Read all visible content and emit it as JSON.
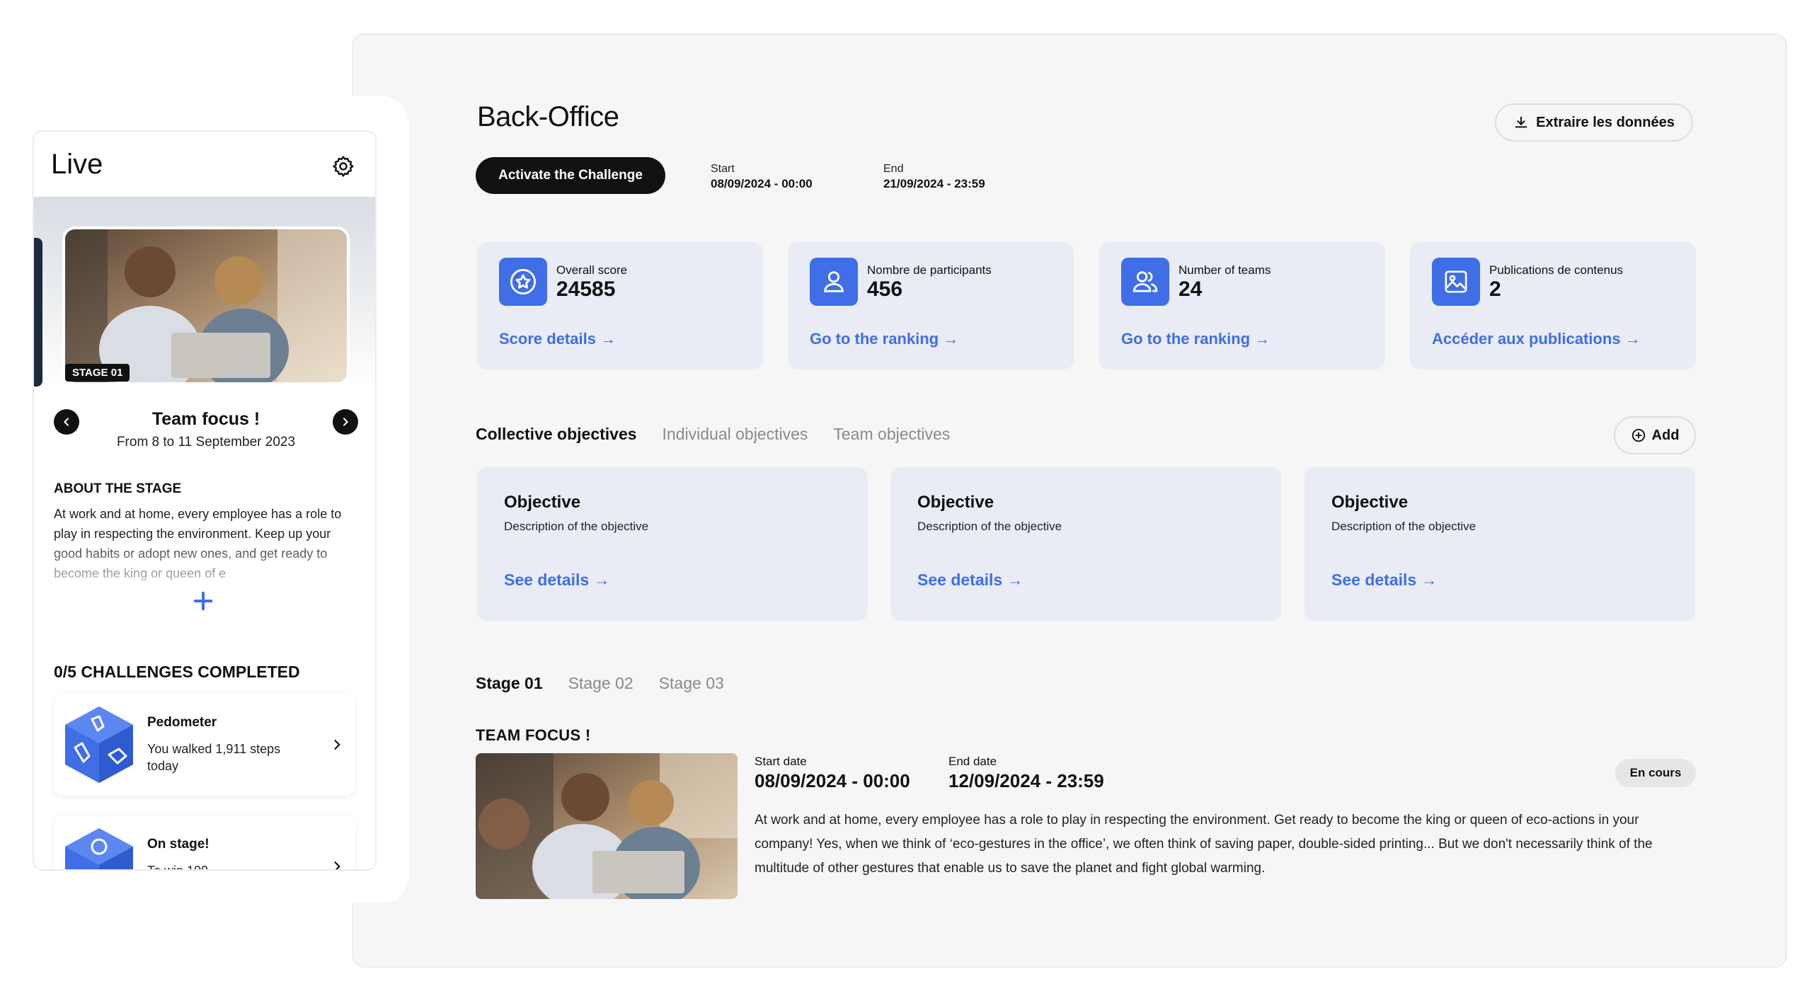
{
  "colors": {
    "accent": "#3f6ee6",
    "card_bg": "#e9ecf4",
    "dark": "#111111",
    "panel_bg": "#f6f6f6"
  },
  "backoffice": {
    "title": "Back-Office",
    "extract_label": "Extraire les données",
    "activate_label": "Activate the Challenge",
    "start_label": "Start",
    "start_value": "08/09/2024 - 00:00",
    "end_label": "End",
    "end_value": "21/09/2024 - 23:59",
    "stats": [
      {
        "icon": "star-badge-icon",
        "label": "Overall score",
        "value": "24585",
        "link": "Score details"
      },
      {
        "icon": "user-icon",
        "label": "Nombre de participants",
        "value": "456",
        "link": "Go to the ranking"
      },
      {
        "icon": "team-icon",
        "label": "Number of teams",
        "value": "24",
        "link": "Go to the ranking"
      },
      {
        "icon": "image-icon",
        "label": "Publications de contenus",
        "value": "2",
        "link": "Accéder aux publications"
      }
    ],
    "objective_tabs": [
      "Collective objectives",
      "Individual objectives",
      "Team objectives"
    ],
    "add_label": "Add",
    "objectives": [
      {
        "title": "Objective",
        "description": "Description of the objective",
        "link": "See details"
      },
      {
        "title": "Objective",
        "description": "Description of the objective",
        "link": "See details"
      },
      {
        "title": "Objective",
        "description": "Description of the objective",
        "link": "See details"
      }
    ],
    "stage_tabs": [
      "Stage 01",
      "Stage 02",
      "Stage 03"
    ],
    "stage": {
      "heading": "TEAM FOCUS !",
      "start_label": "Start date",
      "start_value": "08/09/2024 - 00:00",
      "end_label": "End date",
      "end_value": "12/09/2024 - 23:59",
      "status": "En cours",
      "description": "At work and at home, every employee has a role to play in respecting the environment. Get ready to become the king or queen of eco-actions in your company! Yes, when we think of ‘eco-gestures in the office’, we often think of saving paper, double-sided printing... But we don't necessarily think of the multitude of other gestures that enable us to save the planet and fight global warming."
    }
  },
  "mobile": {
    "title": "Live",
    "stage_tag": "STAGE 01",
    "stage_name": "Team focus !",
    "stage_dates": "From 8 to 11 September 2023",
    "about_heading": "ABOUT THE STAGE",
    "about_text": "At work and at home, every employee has a role to play in respecting the environment. Keep up your good habits or adopt new ones, and get ready to become the king or queen of e",
    "challenges_heading": "0/5 CHALLENGES COMPLETED",
    "challenges": [
      {
        "title": "Pedometer",
        "text": "You walked 1,911 steps today"
      },
      {
        "title": "On stage!",
        "text": "To win 100"
      }
    ]
  }
}
